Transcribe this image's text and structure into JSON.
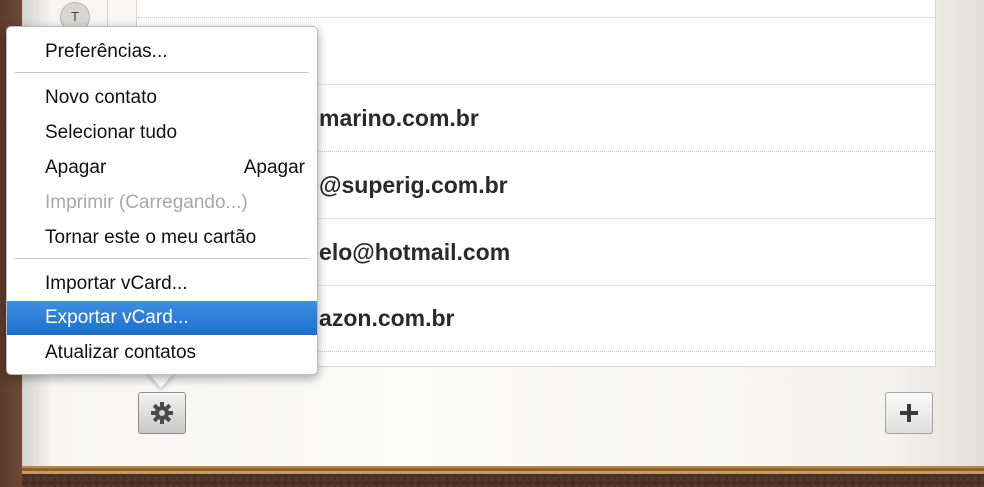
{
  "index_tab": {
    "letter": "T"
  },
  "contacts": [
    {
      "email": "bmarino.com.br"
    },
    {
      "email": "o@superig.com.br"
    },
    {
      "email": "belo@hotmail.com"
    },
    {
      "email": "nazon.com.br"
    }
  ],
  "menu": {
    "preferences": "Preferências...",
    "new_contact": "Novo contato",
    "select_all": "Selecionar tudo",
    "delete": "Apagar",
    "delete_shortcut": "Apagar",
    "print": "Imprimir (Carregando...)",
    "make_my_card": "Tornar este o meu cartão",
    "import_vcard": "Importar vCard...",
    "export_vcard": "Exportar vCard...",
    "refresh_contacts": "Atualizar contatos"
  },
  "toolbar": {
    "gear_icon": "gear-icon",
    "add_icon": "plus-icon"
  },
  "colors": {
    "menu_highlight": "#1d6fcf",
    "leather": "#5b3a2c"
  }
}
